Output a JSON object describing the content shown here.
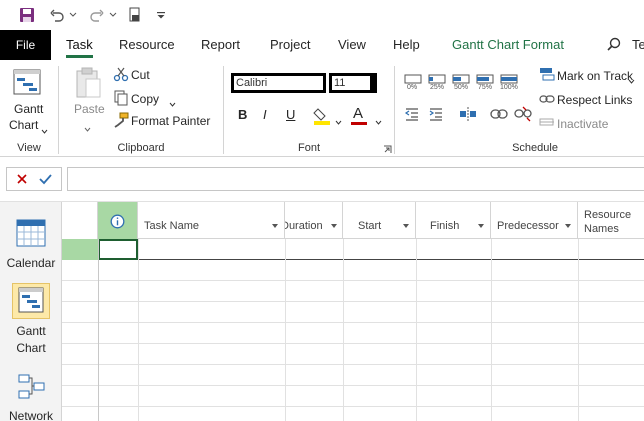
{
  "tabs": {
    "file": "File",
    "task": "Task",
    "resource": "Resource",
    "report": "Report",
    "project": "Project",
    "view": "View",
    "help": "Help",
    "gantt_format": "Gantt Chart Format",
    "tell": "Te"
  },
  "ribbon": {
    "view_group": {
      "label": "View",
      "gantt_line1": "Gantt",
      "gantt_line2": "Chart"
    },
    "clipboard_group": {
      "label": "Clipboard",
      "paste": "Paste",
      "cut": "Cut",
      "copy": "Copy",
      "format_painter": "Format Painter"
    },
    "font_group": {
      "label": "Font",
      "font_name": "Calibri",
      "font_size": "11",
      "bold": "B",
      "italic": "I",
      "underline": "U",
      "font_color": "A"
    },
    "schedule_group": {
      "label": "Schedule",
      "pct": [
        "0%",
        "25%",
        "50%",
        "75%",
        "100%"
      ],
      "mark_on_track": "Mark on Track",
      "respect_links": "Respect Links",
      "inactivate": "Inactivate"
    }
  },
  "viewbar": {
    "calendar": "Calendar",
    "gantt_line1": "Gantt",
    "gantt_line2": "Chart",
    "network": "Network"
  },
  "grid": {
    "columns": {
      "task_name": "Task Name",
      "duration": "Duration",
      "start": "Start",
      "finish": "Finish",
      "predecessors": "Predecessor",
      "resource_line1": "Resource",
      "resource_line2": "Names"
    }
  },
  "colors": {
    "accent": "#217346",
    "row_highlight": "#a9d5a6",
    "header_highlight": "#9fd49a"
  }
}
